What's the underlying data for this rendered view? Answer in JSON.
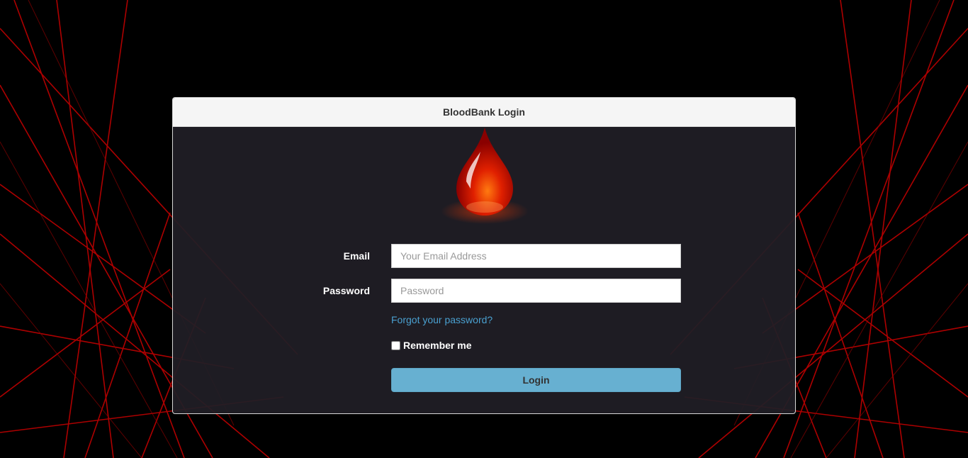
{
  "panel": {
    "title": "BloodBank Login"
  },
  "logo": {
    "icon": "blood-drop-icon",
    "color": "#e01e00"
  },
  "form": {
    "email_label": "Email",
    "email_placeholder": "Your Email Address",
    "email_value": "",
    "password_label": "Password",
    "password_placeholder": "Password",
    "password_value": "",
    "forgot_link": "Forgot your password?",
    "remember_label": "Remember me",
    "remember_checked": false,
    "login_button": "Login"
  },
  "colors": {
    "background": "#000000",
    "accent_red": "#c00000",
    "link": "#4aa0d0",
    "button": "#67b0d1"
  }
}
